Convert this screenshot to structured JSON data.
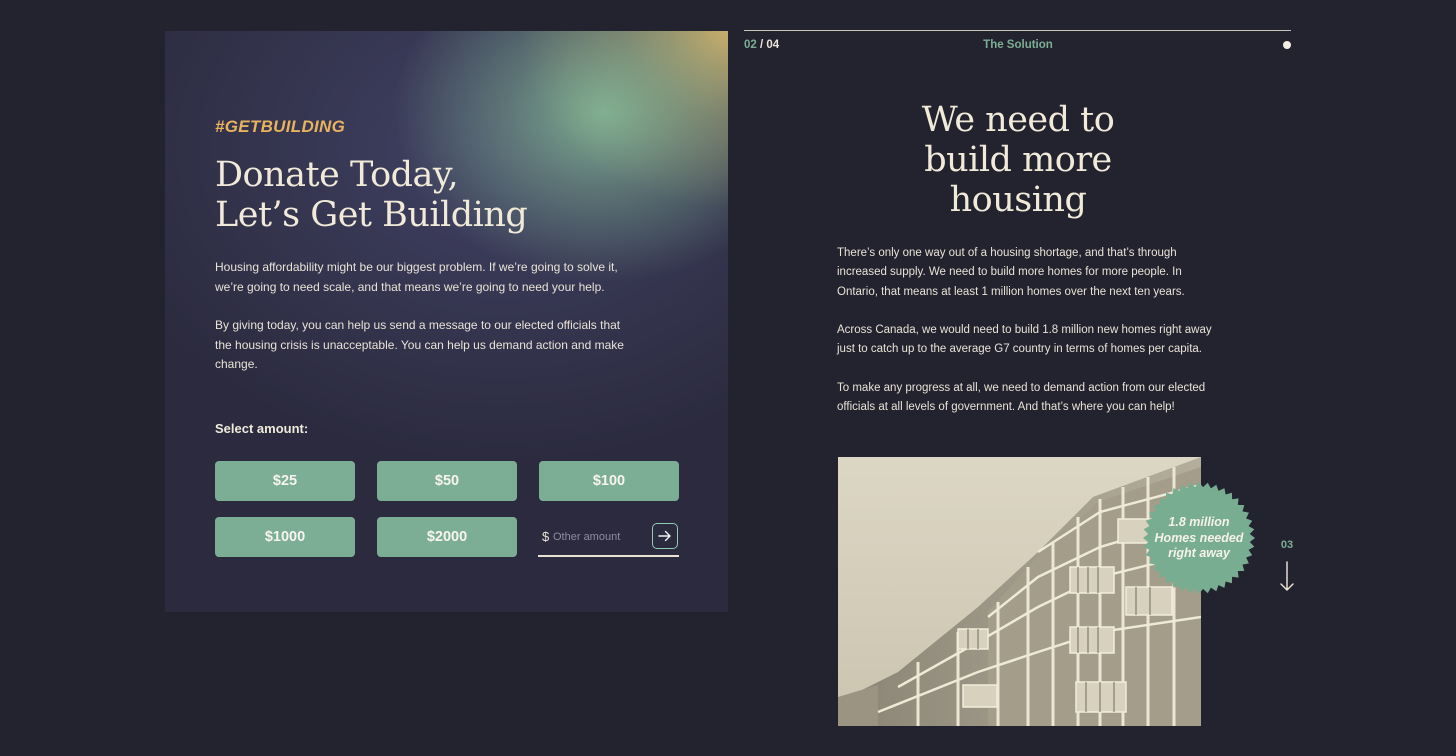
{
  "donate": {
    "tagline": "#GETBUILDING",
    "headline_line1": "Donate Today,",
    "headline_line2": "Let’s Get Building",
    "paragraph1": "Housing affordability might be our biggest problem. If we’re going to solve it, we’re going to need scale, and that means we’re going to need your help.",
    "paragraph2": "By giving today, you can help us send a message to our elected officials that the housing crisis is unacceptable. You can help us demand action and make change.",
    "select_label": "Select amount:",
    "amounts": [
      "$25",
      "$50",
      "$100",
      "$1000",
      "$2000"
    ],
    "currency_symbol": "$",
    "other_placeholder": "Other amount",
    "submit_icon": "arrow-right-icon"
  },
  "solution": {
    "page_current": "02",
    "page_separator": " / ",
    "page_total": "04",
    "section_label": "The Solution",
    "title_line1": "We need to",
    "title_line2": "build more",
    "title_line3": "housing",
    "paragraph1": "There’s only one way out of a housing shortage, and that’s through increased supply. We need to build more homes for more people. In Ontario, that means at least 1 million homes over the next ten years.",
    "paragraph2": "Across Canada, we would need to build 1.8 million new homes right away just to catch up to the average G7 country in terms of homes per capita.",
    "paragraph3": "To make any progress at all, we need to demand action from our elected officials at all levels of government. And that’s where you can help!",
    "badge_line1": "1.8 million",
    "badge_line2": "Homes needed",
    "badge_line3": "right away",
    "next_page": "03",
    "next_icon": "arrow-down-icon",
    "photo_subject": "building-under-construction-photo"
  },
  "colors": {
    "background": "#23222f",
    "card": "#2b2a3e",
    "accent_green": "#7bae94",
    "accent_gold": "#e8b25e",
    "text_light": "#f1ead9"
  }
}
